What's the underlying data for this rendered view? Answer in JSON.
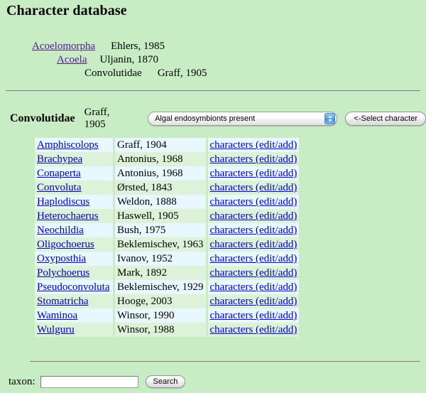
{
  "page": {
    "title": "Character database",
    "background_color": "#c8ecc4"
  },
  "hierarchy": [
    {
      "name": "Acoelomorpha ",
      "authority": "Ehlers, 1985",
      "is_link": true,
      "level": 0
    },
    {
      "name": "Acoela ",
      "authority": "Uljanin, 1870",
      "is_link": true,
      "level": 1
    },
    {
      "name": "Convolutidae",
      "authority": "Graff, 1905",
      "is_link": false,
      "level": 2
    }
  ],
  "selection_bar": {
    "family_name": "Convolutidae",
    "family_authority": "Graff, 1905",
    "character_select": {
      "selected": "Algal endosymbionts present",
      "options": [
        "Algal endosymbionts present"
      ]
    },
    "select_button_label": "<-Select character"
  },
  "table": {
    "columns": [
      "genus",
      "authority",
      "characters"
    ],
    "characters_link_label": "characters (edit/add)",
    "rows": [
      {
        "genus": "Amphiscolops",
        "authority": "Graff, 1904"
      },
      {
        "genus": "Brachypea",
        "authority": "Antonius, 1968"
      },
      {
        "genus": "Conaperta",
        "authority": "Antonius, 1968"
      },
      {
        "genus": "Convoluta",
        "authority": "Ørsted, 1843"
      },
      {
        "genus": "Haplodiscus",
        "authority": "Weldon, 1888"
      },
      {
        "genus": "Heterochaerus",
        "authority": "Haswell, 1905"
      },
      {
        "genus": "Neochildia",
        "authority": "Bush, 1975"
      },
      {
        "genus": "Oligochoerus",
        "authority": "Beklemischev, 1963"
      },
      {
        "genus": "Oxyposthia",
        "authority": "Ivanov, 1952"
      },
      {
        "genus": "Polychoerus",
        "authority": "Mark, 1892"
      },
      {
        "genus": "Pseudoconvoluta",
        "authority": "Beklemischev, 1929"
      },
      {
        "genus": "Stomatricha",
        "authority": "Hooge, 2003"
      },
      {
        "genus": "Waminoa",
        "authority": "Winsor, 1990"
      },
      {
        "genus": "Wulguru",
        "authority": "Winsor, 1988"
      }
    ]
  },
  "search": {
    "label": "taxon:",
    "value": "",
    "placeholder": "",
    "button_label": "Search"
  },
  "colors": {
    "page_background": "#c8ecc4",
    "row_light": "#e9f8ff",
    "row_green": "#ddf2d8",
    "link_blue": "#0000cc",
    "link_visited": "#551a8b"
  }
}
